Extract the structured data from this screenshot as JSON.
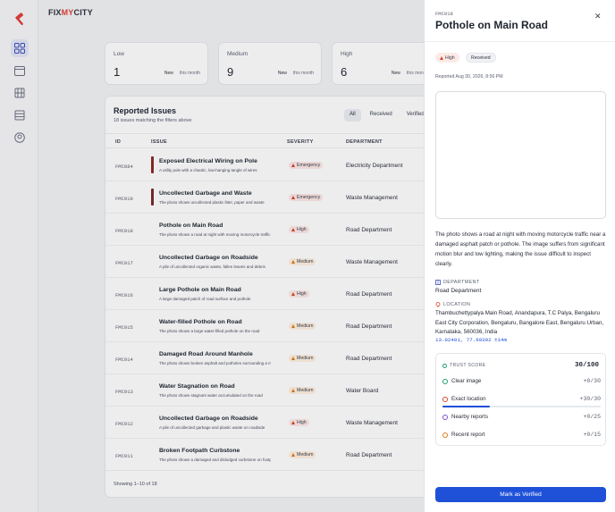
{
  "app": {
    "brand_prefix": "FIX",
    "brand_mid": "MY",
    "brand_suffix": "CITY"
  },
  "stats": [
    {
      "label": "Low",
      "value": "1",
      "new_label": "New",
      "period": "this month"
    },
    {
      "label": "Medium",
      "value": "9",
      "new_label": "New",
      "period": "this month"
    },
    {
      "label": "High",
      "value": "6",
      "new_label": "New",
      "period": "this month"
    }
  ],
  "panel": {
    "title": "Reported Issues",
    "subtitle": "18 issues matching the filters above",
    "filters": [
      "All",
      "Received",
      "Verified"
    ],
    "columns": {
      "id": "ID",
      "issue": "ISSUE",
      "severity": "SEVERITY",
      "department": "DEPARTMENT"
    },
    "footer": "Showing 1–10 of 18"
  },
  "rows": [
    {
      "id": "FMC884",
      "title": "Exposed Electrical Wiring on Pole",
      "desc": "A utility pole with a chaotic, low-hanging tangle of wires",
      "severity": "Emergency",
      "sev_class": "emergency",
      "department": "Electricity Department",
      "thumb_color": "#8a2b22"
    },
    {
      "id": "FMC919",
      "title": "Uncollected Garbage and Waste",
      "desc": "The photo shows uncollected plastic litter, paper and waste",
      "severity": "Emergency",
      "sev_class": "emergency",
      "department": "Waste Management",
      "thumb_color": "#7a2a24"
    },
    {
      "id": "FMC918",
      "title": "Pothole on Main Road",
      "desc": "The photo shows a road at night with moving motorcycle traffic",
      "severity": "High",
      "sev_class": "high",
      "department": "Road Department",
      "thumb_color": ""
    },
    {
      "id": "FMC917",
      "title": "Uncollected Garbage on Roadside",
      "desc": "A pile of uncollected organic waste, fallen leaves and debris",
      "severity": "Medium",
      "sev_class": "medium",
      "department": "Waste Management",
      "thumb_color": ""
    },
    {
      "id": "FMC916",
      "title": "Large Pothole on Main Road",
      "desc": "A large damaged patch of road surface and pothole",
      "severity": "High",
      "sev_class": "high",
      "department": "Road Department",
      "thumb_color": ""
    },
    {
      "id": "FMC915",
      "title": "Water-filled Pothole on Road",
      "desc": "The photo shows a large water-filled pothole on the road",
      "severity": "Medium",
      "sev_class": "medium",
      "department": "Road Department",
      "thumb_color": ""
    },
    {
      "id": "FMC914",
      "title": "Damaged Road Around Manhole",
      "desc": "The photo shows broken asphalt and potholes surrounding a manhole",
      "severity": "Medium",
      "sev_class": "medium",
      "department": "Road Department",
      "thumb_color": ""
    },
    {
      "id": "FMC913",
      "title": "Water Stagnation on Road",
      "desc": "The photo shows stagnant water accumulated on the road",
      "severity": "Medium",
      "sev_class": "medium",
      "department": "Water Board",
      "thumb_color": ""
    },
    {
      "id": "FMC912",
      "title": "Uncollected Garbage on Roadside",
      "desc": "A pile of uncollected garbage and plastic waste on roadside",
      "severity": "High",
      "sev_class": "high",
      "department": "Waste Management",
      "thumb_color": ""
    },
    {
      "id": "FMC911",
      "title": "Broken Footpath Curbstone",
      "desc": "The photo shows a damaged and dislodged curbstone on footpath",
      "severity": "Medium",
      "sev_class": "medium",
      "department": "Road Department",
      "thumb_color": ""
    }
  ],
  "drawer": {
    "id": "FMC918",
    "title": "Pothole on Main Road",
    "severity": "High",
    "status": "Received",
    "reported": "Reported Aug 30, 2026, 8:56 PM",
    "description": "The photo shows a road at night with moving motorcycle traffic near a damaged asphalt patch or pothole. The image suffers from significant motion blur and low lighting, making the issue difficult to inspect clearly.",
    "department_label": "DEPARTMENT",
    "department": "Road Department",
    "location_label": "LOCATION",
    "address": "Thambuchettypalya Main Road, Anandapura, T.C Palya, Bengaluru East City Corporation, Bengaluru, Bangalore East, Bengaluru Urban, Karnataka, 560036, India",
    "coords": "13.02401, 77.69392 ±14m",
    "trust": {
      "label": "TRUST SCORE",
      "total": "30/100",
      "progress": 0.3,
      "items": [
        {
          "label": "Clear image",
          "points": "+0/30",
          "color": "#1f9d6b"
        },
        {
          "label": "Exact location",
          "points": "+30/30",
          "color": "#d9442a"
        },
        {
          "label": "Nearby reports",
          "points": "+0/25",
          "color": "#7b4fd8"
        },
        {
          "label": "Recent report",
          "points": "+0/15",
          "color": "#e07b1a"
        }
      ]
    },
    "action": "Mark as Verified"
  }
}
